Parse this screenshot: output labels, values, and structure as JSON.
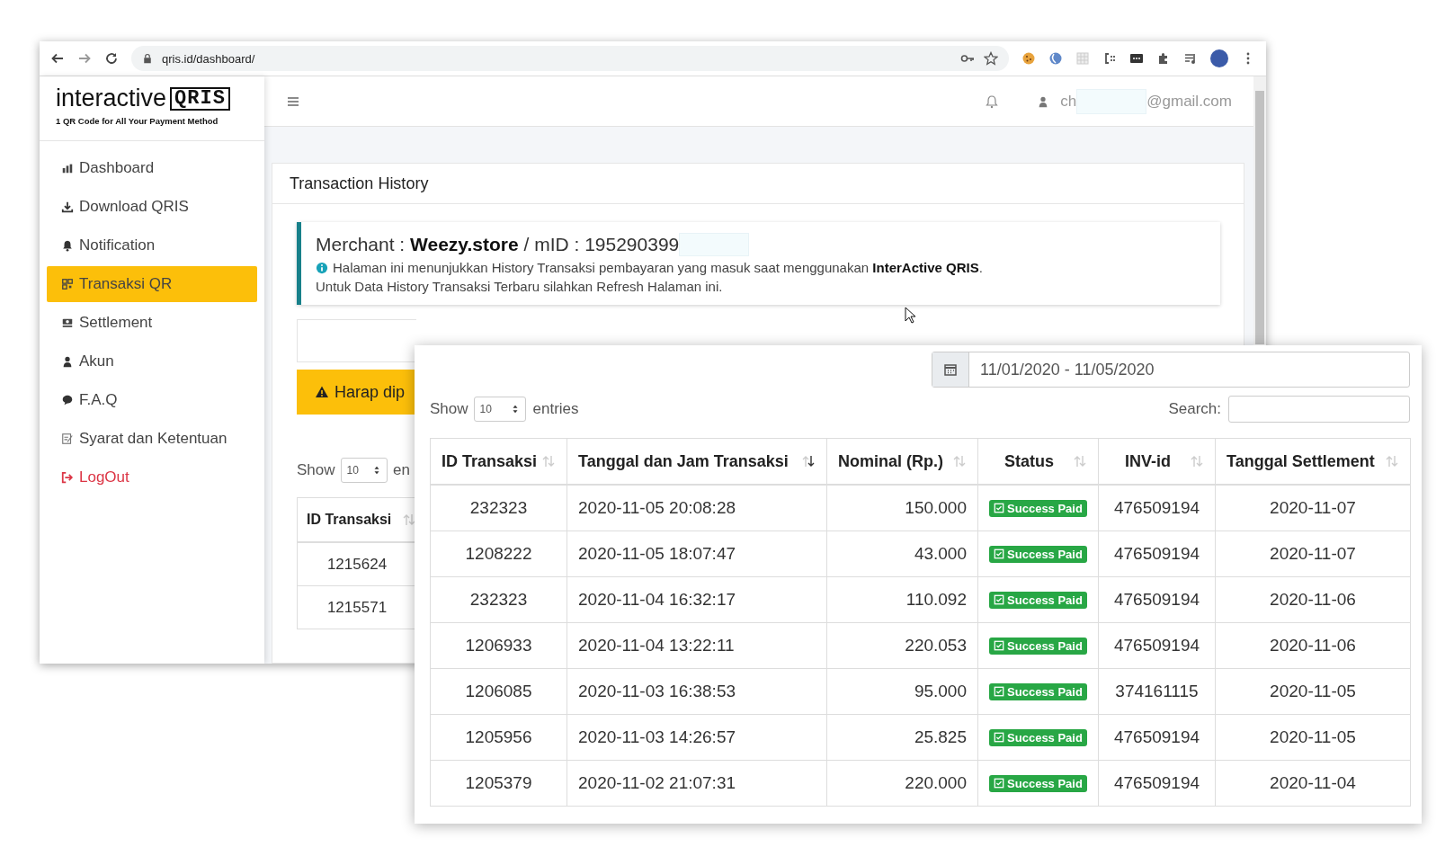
{
  "browser": {
    "url": "qris.id/dashboard/"
  },
  "logo": {
    "name": "interactive",
    "mark": "QRIS",
    "tagline": "1 QR Code for All Your Payment Method"
  },
  "sidebar": {
    "items": [
      {
        "label": "Dashboard",
        "kind": "link",
        "selected": false
      },
      {
        "label": "Download QRIS",
        "kind": "link",
        "selected": false
      },
      {
        "label": "Notification",
        "kind": "link",
        "selected": false
      },
      {
        "label": "Transaksi QR",
        "kind": "link",
        "selected": true
      },
      {
        "label": "Settlement",
        "kind": "link",
        "selected": false
      },
      {
        "label": "Akun",
        "kind": "link",
        "selected": false
      },
      {
        "label": "F.A.Q",
        "kind": "link",
        "selected": false
      },
      {
        "label": "Syarat dan Ketentuan",
        "kind": "link",
        "selected": false
      },
      {
        "label": "LogOut",
        "kind": "logout",
        "selected": false
      }
    ]
  },
  "header": {
    "user_prefix": "ch",
    "user_suffix": "@gmail.com"
  },
  "card": {
    "title": "Transaction History",
    "merchant": "Merchant : **Weezy.store** / mID : 195290399",
    "note_lines": [
      "Halaman ini menunjukkan History Transaksi pembayaran yang masuk saat menggunakan **InterActive QRIS**.",
      "Untuk Data History Transaksi Terbaru silahkan Refresh Halaman ini."
    ],
    "warning": "Harap dip",
    "show": "Show",
    "length": "10",
    "entries": "en",
    "table": {
      "column": "ID Transaksi",
      "rows": [
        "1215624",
        "1215571"
      ]
    }
  },
  "panel": {
    "date_range": "11/01/2020 - 11/05/2020",
    "show": "Show",
    "length": "10",
    "entries": "entries",
    "search_label": "Search:",
    "columns": [
      {
        "label": "ID Transaksi",
        "sorted_desc": false
      },
      {
        "label": "Tanggal dan Jam Transaksi",
        "sorted_desc": true
      },
      {
        "label": "Nominal (Rp.)",
        "sorted_desc": false
      },
      {
        "label": "Status",
        "sorted_desc": false
      },
      {
        "label": "INV-id",
        "sorted_desc": false
      },
      {
        "label": "Tanggal Settlement",
        "sorted_desc": false
      }
    ],
    "rows": [
      {
        "id": "232323",
        "datetime": "2020-11-05 20:08:28",
        "nominal": "150.000",
        "status": {
          "label": "Success Paid",
          "kind": "success"
        },
        "inv": "476509194",
        "settlement": "2020-11-07"
      },
      {
        "id": "1208222",
        "datetime": "2020-11-05 18:07:47",
        "nominal": "43.000",
        "status": {
          "label": "Success Paid",
          "kind": "success"
        },
        "inv": "476509194",
        "settlement": "2020-11-07"
      },
      {
        "id": "232323",
        "datetime": "2020-11-04 16:32:17",
        "nominal": "110.092",
        "status": {
          "label": "Success Paid",
          "kind": "success"
        },
        "inv": "476509194",
        "settlement": "2020-11-06"
      },
      {
        "id": "1206933",
        "datetime": "2020-11-04 13:22:11",
        "nominal": "220.053",
        "status": {
          "label": "Success Paid",
          "kind": "success"
        },
        "inv": "476509194",
        "settlement": "2020-11-06"
      },
      {
        "id": "1206085",
        "datetime": "2020-11-03 16:38:53",
        "nominal": "95.000",
        "status": {
          "label": "Success Paid",
          "kind": "success"
        },
        "inv": "374161115",
        "settlement": "2020-11-05"
      },
      {
        "id": "1205956",
        "datetime": "2020-11-03 14:26:57",
        "nominal": "25.825",
        "status": {
          "label": "Success Paid",
          "kind": "success"
        },
        "inv": "476509194",
        "settlement": "2020-11-05"
      },
      {
        "id": "1205379",
        "datetime": "2020-11-02 21:07:31",
        "nominal": "220.000",
        "status": {
          "label": "Success Paid",
          "kind": "success"
        },
        "inv": "476509194",
        "settlement": "2020-11-04"
      }
    ]
  }
}
